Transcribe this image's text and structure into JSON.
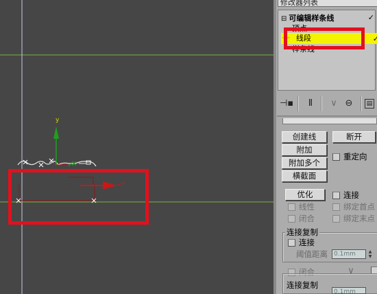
{
  "modifier_list": {
    "header": "修改器列表"
  },
  "stack": {
    "root": "可编辑样条线",
    "items": [
      "顶点",
      "线段",
      "样条线"
    ],
    "selected_index": 1,
    "checkmark": "✓"
  },
  "toolbar": {
    "icons": [
      "pin-stack-icon",
      "show-end-result-icon",
      "make-unique-icon",
      "remove-modifier-icon",
      "configure-sets-icon"
    ]
  },
  "geometry": {
    "create_line": "创建线",
    "break": "断开",
    "attach": "附加",
    "reorient": "重定向",
    "attach_mult": "附加多个",
    "cross_section": "横截面",
    "refine": "优化",
    "connect": "连接",
    "linear": "线性",
    "bind_first": "绑定首点",
    "closed": "闭合",
    "bind_last": "绑定末点"
  },
  "connect_copy": {
    "title": "连接复制",
    "connect": "连接",
    "threshold_label": "阈值距离",
    "threshold_value": "0.1mm"
  },
  "bottom": {
    "closed": "闭合",
    "connect_copy_title": "连接复制",
    "threshold_value": "0.1mm"
  },
  "viewport": {
    "axis_y_label": "y",
    "colors": {
      "background": "#464646",
      "grid": "#78b43c",
      "axis_y": "#1ea01e",
      "axis_x": "#c81818",
      "annotation": "#e3101d",
      "highlight": "#f4f400"
    }
  }
}
